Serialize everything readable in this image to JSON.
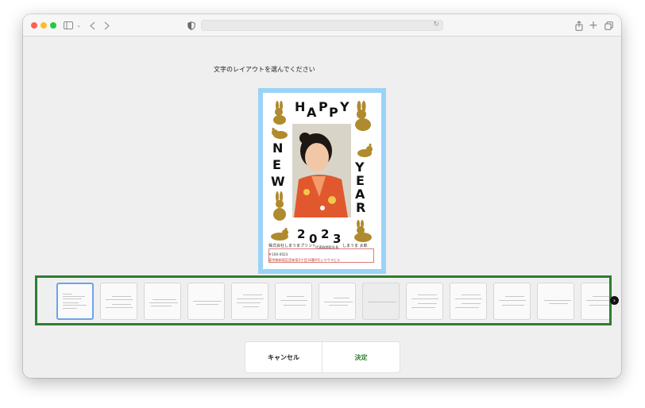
{
  "window": {
    "traffic_lights": [
      "close",
      "minimize",
      "zoom"
    ],
    "toolbar": {
      "sidebar_icon": "sidebar-icon",
      "back_icon": "chevron-left-icon",
      "forward_icon": "chevron-right-icon",
      "privacy_icon": "shield-icon",
      "address_value": "",
      "reload_icon": "reload-icon",
      "share_icon": "share-icon",
      "new_tab_icon": "plus-icon",
      "tabs_icon": "tabs-icon"
    }
  },
  "page": {
    "instruction": "文字のレイアウトを選んでください"
  },
  "card": {
    "greeting_letters": [
      "H",
      "A",
      "P",
      "P",
      "Y",
      "N",
      "E",
      "W",
      "Y",
      "E",
      "A",
      "R"
    ],
    "year_digits": [
      "2",
      "0",
      "2",
      "3"
    ],
    "sender": {
      "company": "株式会社しまうまプリント",
      "title": "代表取締役社長",
      "name": "しまうま 太郎",
      "postal": "〒160-0023",
      "address": "東京都新宿区西新宿3丁目16番9号シマウマビル"
    },
    "colors": {
      "frame": "#9bd3f7",
      "rabbit": "#b08a2e",
      "kimono": "#e2582e"
    }
  },
  "layout_options": {
    "count_visible": 13,
    "selected_index": 0,
    "next_icon": "chevron-right-icon"
  },
  "actions": {
    "cancel_label": "キャンセル",
    "confirm_label": "決定"
  }
}
